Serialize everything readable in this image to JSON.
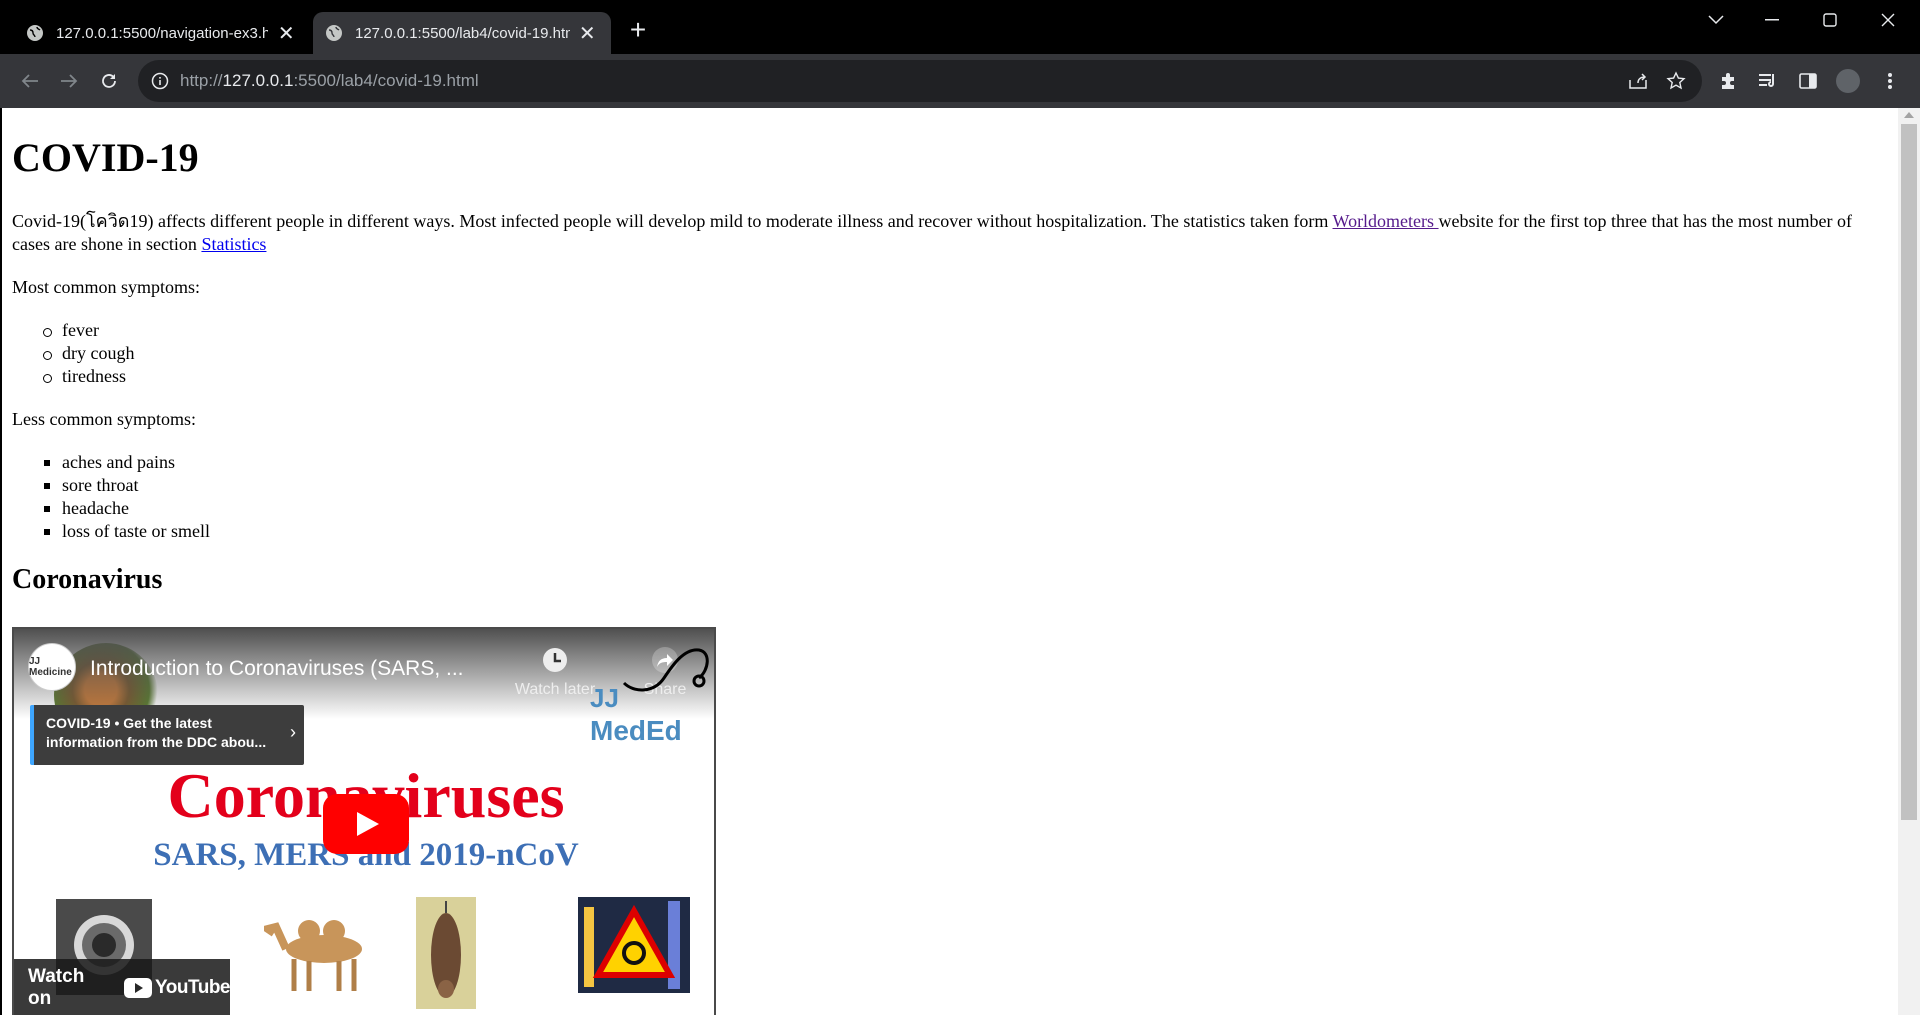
{
  "browser": {
    "tabs": [
      {
        "title": "127.0.0.1:5500/navigation-ex3.html",
        "active": false
      },
      {
        "title": "127.0.0.1:5500/lab4/covid-19.html",
        "active": true
      }
    ],
    "address": {
      "scheme": "http://",
      "host": "127.0.0.1",
      "rest": ":5500/lab4/covid-19.html"
    },
    "icons": {
      "new_tab": "+",
      "close": "✕",
      "minimize": "minimize-icon",
      "maximize": "maximize-icon",
      "window_close": "close-icon"
    }
  },
  "page": {
    "heading": "COVID-19",
    "intro": {
      "before_link1": "Covid-19(โควิด19) affects different people in different ways. Most infected people will develop mild to moderate illness and recover without hospitalization. The statistics taken form ",
      "link1": "Worldometers ",
      "between": "website for the first top three that has the most number of cases are shone in section ",
      "link2": "Statistics"
    },
    "common_label": "Most common symptoms:",
    "common_symptoms": [
      "fever",
      "dry cough",
      "tiredness"
    ],
    "less_label": "Less common symptoms:",
    "less_symptoms": [
      "aches and pains",
      "sore throat",
      "headache",
      "loss of taste or smell"
    ],
    "subheading": "Coronavirus"
  },
  "video": {
    "channel_logo_text": "JJ Medicine",
    "title": "Introduction to Coronaviruses (SARS, ...",
    "watch_later": "Watch later",
    "share": "Share",
    "brand_line1": "JJ",
    "brand_line2": "MedEd",
    "info_card": "COVID-19 • Get the latest information from the DDC abou...",
    "big_title": "Coronaviruses",
    "subtitle": "SARS, MERS and 2019-nCoV",
    "watch_on": "Watch on",
    "youtube": "YouTube"
  }
}
